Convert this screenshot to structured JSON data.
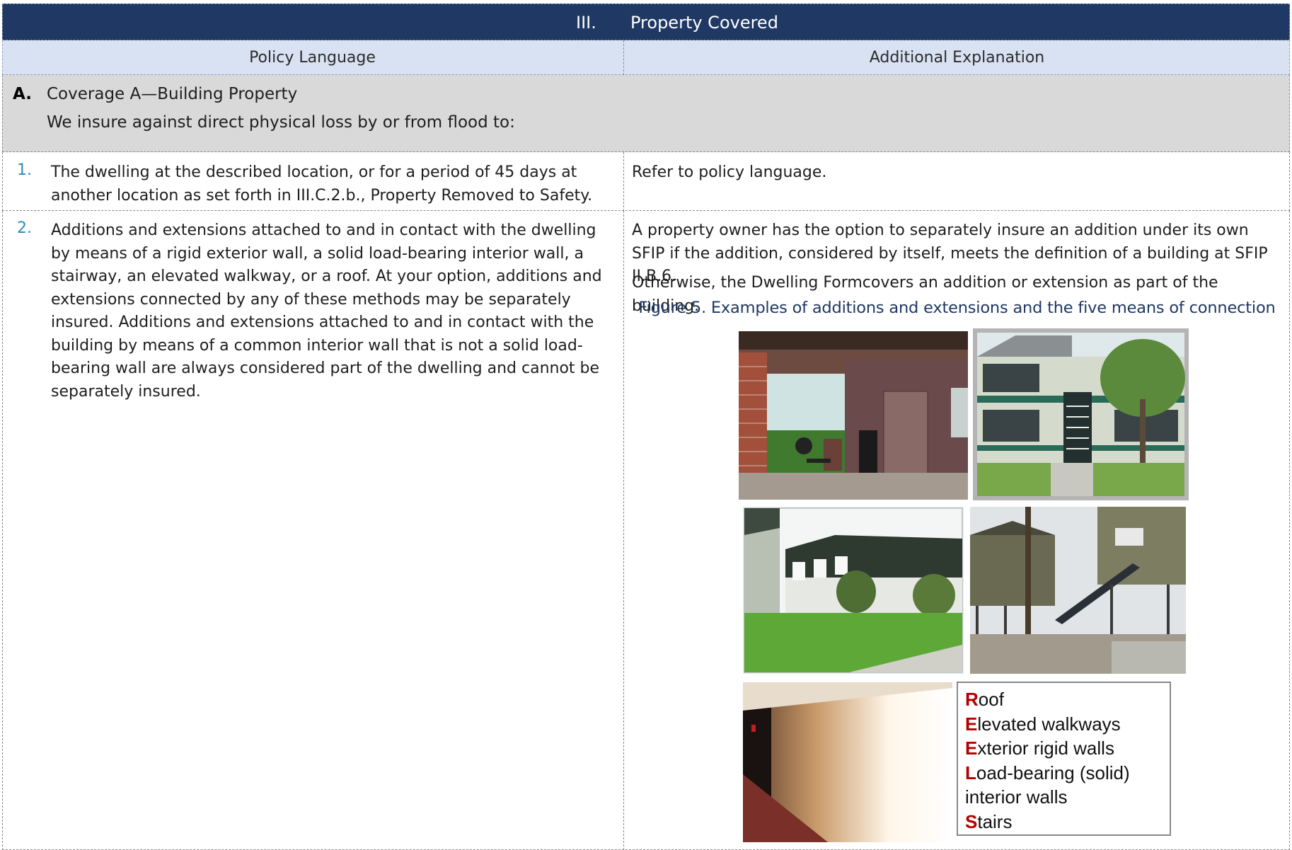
{
  "section": {
    "number": "III.",
    "title": "Property Covered"
  },
  "columns": {
    "left": "Policy Language",
    "right": "Additional Explanation"
  },
  "coverage": {
    "letter": "A.",
    "title": "Coverage A—Building Property",
    "intro": "We insure against direct physical loss by or from flood to:"
  },
  "items": [
    {
      "number": "1.",
      "policy": "The dwelling at the described location, or for a period of 45 days at another location as set forth in III.C.2.b., Property Removed to Safety.",
      "explanation": "Refer to policy language."
    },
    {
      "number": "2.",
      "policy": "Additions and extensions attached to and in contact with the dwelling by means of a rigid exterior wall, a solid load-bearing interior wall, a stairway, an elevated walkway, or a roof. At your option, additions and extensions connected by any of these methods may be separately insured. Additions and extensions attached to and in contact with the building by means of a common interior wall that is not a solid load-bearing wall are always considered part of the dwelling and cannot be separately insured.",
      "explanation_p1": "A property owner has the option to separately insure an addition under its own SFIP if the addition, considered by itself, meets the definition of a building at SFIP II.B.6.",
      "explanation_p2": "Otherwise, the Dwelling Formcovers an addition or extension as part of the building."
    }
  ],
  "figure": {
    "caption": "Figure 5. Examples of additions and extensions and the five means of connection",
    "legend": [
      {
        "initial": "R",
        "rest": "oof"
      },
      {
        "initial": "E",
        "rest": "levated walkways"
      },
      {
        "initial": "E",
        "rest": "xterior rigid walls"
      },
      {
        "initial": "L",
        "rest": "oad-bearing (solid)"
      },
      {
        "initial": "",
        "rest": "interior walls"
      },
      {
        "initial": "S",
        "rest": "tairs"
      }
    ]
  },
  "colors": {
    "header_bg": "#1f3864",
    "column_header_bg": "#d9e2f3",
    "coverage_bg": "#d9d9d9",
    "item_number": "#2e8bc0",
    "legend_initial": "#b50000"
  }
}
